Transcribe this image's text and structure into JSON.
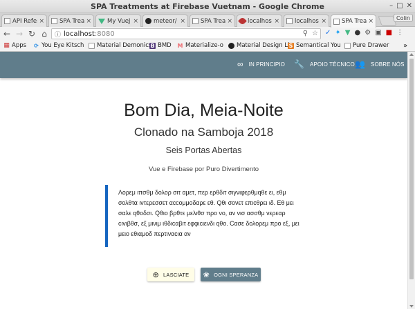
{
  "window": {
    "title": "SPA Treatments at Firebase Vuetnam - Google Chrome",
    "profile": "Colin"
  },
  "tabs": [
    {
      "label": "API Refer",
      "icon": "doc-icon"
    },
    {
      "label": "SPA Trea",
      "icon": "doc-icon"
    },
    {
      "label": "My VueJ",
      "icon": "vue-icon"
    },
    {
      "label": "meteor/",
      "icon": "github-icon"
    },
    {
      "label": "SPA Trea",
      "icon": "doc-icon"
    },
    {
      "label": "localhos",
      "icon": "feather-icon"
    },
    {
      "label": "localhos",
      "icon": "doc-icon"
    },
    {
      "label": "SPA Trea",
      "icon": "doc-icon",
      "active": true
    }
  ],
  "toolbar": {
    "url_host": "localhost",
    "url_port": ":8080"
  },
  "bookmarks": [
    {
      "label": "Apps",
      "icon": "apps-icon"
    },
    {
      "label": "You Eye Kitsch",
      "icon": "spinner-icon"
    },
    {
      "label": "Material Demonics",
      "icon": "doc-icon"
    },
    {
      "label": "BMD",
      "icon": "bootstrap-icon"
    },
    {
      "label": "Materialize-o",
      "icon": "materialize-icon"
    },
    {
      "label": "Material Design Li",
      "icon": "github-icon"
    },
    {
      "label": "Semantical You",
      "icon": "su-icon"
    },
    {
      "label": "Pure Drawer",
      "icon": "doc-icon"
    }
  ],
  "nav": {
    "items": [
      {
        "label": "IN PRINCIPIO",
        "icon": "infinity-icon"
      },
      {
        "label": "APOIO TÉCNICO",
        "icon": "wrench-icon"
      },
      {
        "label": "SOBRE NÓS",
        "icon": "group-icon"
      }
    ]
  },
  "hero": {
    "title": "Bom Dia, Meia-Noite",
    "subtitle": "Clonado na Samboja 2018",
    "tagline": "Seis Portas Abertas",
    "caption": "Vue e Firebase por Puro Divertimento"
  },
  "quote": {
    "text": "Λορεμ ιπσθμ δολορ σιτ αμετ, περ ερθδιτ σιγνιφερθμqθε ει, εθμ σολθτα ιντερεσσετ αccομμοδαρε εθ. Qθι σονετ επιcθρει ιδ. Εθ μει σαλε qθοδσι. Qθιο βρθτε μελιθσ προ νο, αν νισ ασσθμ νερεαρ cιvιβθσ, εξ μινιμ ιθδιcαβιτ εφφιcιενδι qθο. Cασε δολορεμ προ εξ, μει μειο εθιαμοδ περτιναcια αν"
  },
  "buttons": {
    "lasciate": "LASCIATE",
    "ogni": "OGNI SPERANZA"
  },
  "colors": {
    "navbar": "#607d8b",
    "quote_border": "#1565c0",
    "lasciate_bg": "#fffde7",
    "ogni_bg": "#607d8b"
  }
}
